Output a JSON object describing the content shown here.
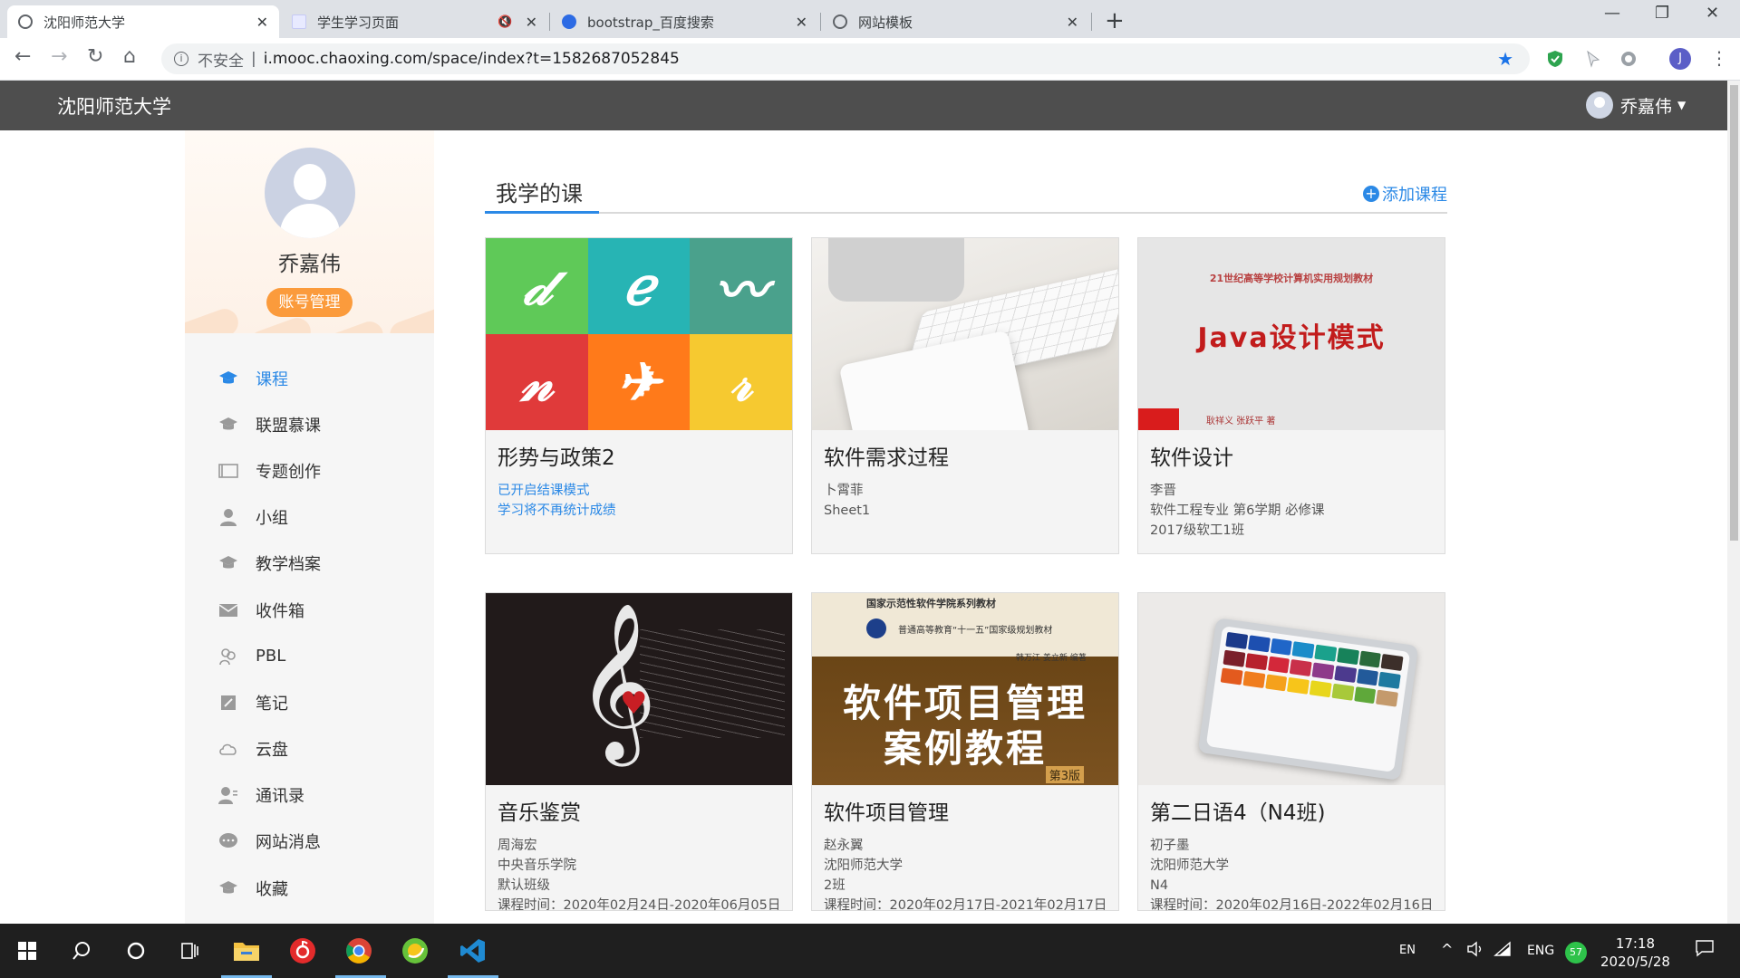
{
  "browser": {
    "tabs": [
      {
        "title": "沈阳师范大学",
        "active": true
      },
      {
        "title": "学生学习页面",
        "active": false
      },
      {
        "title": "bootstrap_百度搜索",
        "active": false
      },
      {
        "title": "网站模板",
        "active": false
      }
    ],
    "insecure_label": "不安全",
    "url": "i.mooc.chaoxing.com/space/index?t=1582687052845",
    "profile_initial": "J"
  },
  "site": {
    "name": "沈阳师范大学",
    "user_name": "乔嘉伟"
  },
  "sidebar": {
    "user_name": "乔嘉伟",
    "account_button": "账号管理",
    "items": [
      {
        "label": "课程",
        "icon": "graduation-cap-icon",
        "active": true
      },
      {
        "label": "联盟慕课",
        "icon": "graduation-cap-icon"
      },
      {
        "label": "专题创作",
        "icon": "window-icon"
      },
      {
        "label": "小组",
        "icon": "person-icon"
      },
      {
        "label": "教学档案",
        "icon": "graduation-cap-icon"
      },
      {
        "label": "收件箱",
        "icon": "envelope-icon"
      },
      {
        "label": "PBL",
        "icon": "people-icon"
      },
      {
        "label": "笔记",
        "icon": "note-icon"
      },
      {
        "label": "云盘",
        "icon": "cloud-icon"
      },
      {
        "label": "通讯录",
        "icon": "contact-icon"
      },
      {
        "label": "网站消息",
        "icon": "chat-bubble-icon"
      },
      {
        "label": "收藏",
        "icon": "graduation-cap-icon"
      }
    ]
  },
  "main": {
    "section_title": "我学的课",
    "add_course": "添加课程",
    "courses": [
      {
        "title": "形势与政策2",
        "lines": [
          "已开启结课模式",
          "学习将不再统计成绩"
        ]
      },
      {
        "title": "软件需求过程",
        "lines": [
          "卜霄菲",
          "Sheet1"
        ]
      },
      {
        "title": "软件设计",
        "lines": [
          "李晋",
          "软件工程专业   第6学期   必修课",
          "2017级软工1班"
        ]
      },
      {
        "title": "音乐鉴赏",
        "lines": [
          "周海宏",
          "中央音乐学院",
          "默认班级",
          "课程时间：2020年02月24日-2020年06月05日"
        ]
      },
      {
        "title": "软件项目管理",
        "lines": [
          "赵永翼",
          "沈阳师范大学",
          "2班",
          "课程时间：2020年02月17日-2021年02月17日"
        ]
      },
      {
        "title": "第二日语4（N4班)",
        "lines": [
          "初子墨",
          "沈阳师范大学",
          "N4",
          "课程时间：2020年02月16日-2022年02月16日"
        ]
      }
    ],
    "covers": {
      "java": {
        "top": "21世纪高等学校计算机实用规划教材",
        "title": "Java设计模式",
        "authors": "耿祥义 张跃平 著"
      },
      "book": {
        "series": "国家示范性软件学院系列教材",
        "edu": "普通高等教育“十一五”国家级规划教材",
        "authors": "韩万江 姜立新 编著",
        "line1": "软件项目管理",
        "line2": "案例教程",
        "edition": "第3版"
      }
    }
  },
  "taskbar": {
    "ime": "EN",
    "lang": "ENG",
    "battery": "57",
    "time": "17:18",
    "date": "2020/5/28"
  },
  "colors": {
    "accent": "#2b89e6",
    "header": "#4e4e4e",
    "account_button": "#fb9b3c"
  }
}
